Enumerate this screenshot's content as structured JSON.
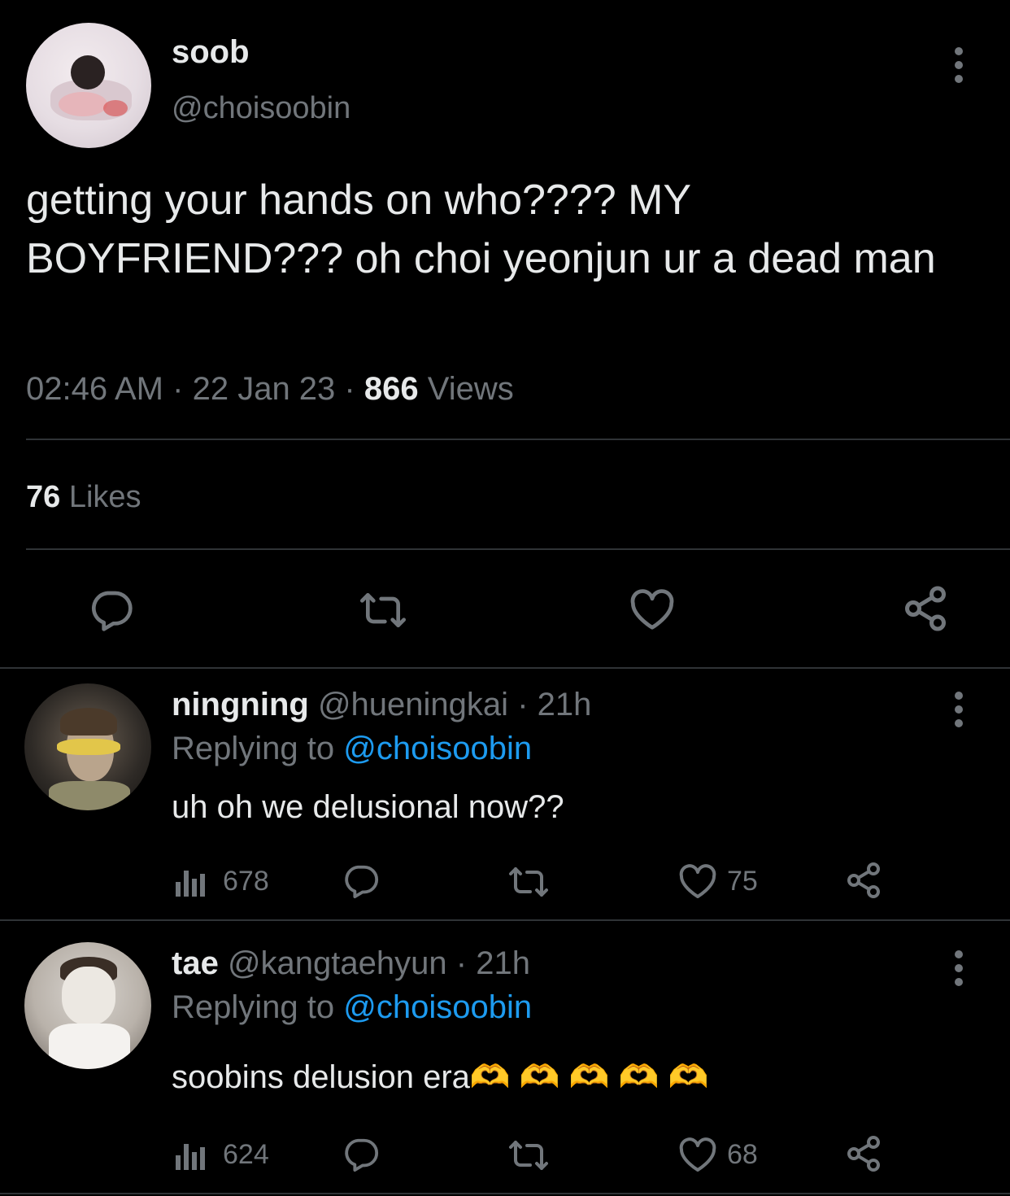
{
  "tweet": {
    "display_name": "soob",
    "handle": "@choisoobin",
    "text": "getting your hands on who???? MY BOYFRIEND??? oh choi yeonjun ur a dead man",
    "time": "02:46 AM",
    "date": "22 Jan 23",
    "separator": "·",
    "views_count": "866",
    "views_label": "Views",
    "likes_count": "76",
    "likes_label": "Likes"
  },
  "replies": [
    {
      "display_name": "ningning",
      "handle": "@hueningkai",
      "age": "21h",
      "replying_label": "Replying to",
      "replying_handle": "@choisoobin",
      "text": "uh oh we delusional now??",
      "views": "678",
      "likes": "75"
    },
    {
      "display_name": "tae",
      "handle": "@kangtaehyun",
      "age": "21h",
      "replying_label": "Replying to",
      "replying_handle": "@choisoobin",
      "text": "soobins delusion era",
      "emoji": "🫶 🫶 🫶 🫶 🫶",
      "views": "624",
      "likes": "68"
    }
  ],
  "colors": {
    "background": "#000000",
    "text": "#e7e9ea",
    "muted": "#71767b",
    "link": "#1d9bf0",
    "divider": "#2f3336"
  },
  "icons": [
    "more-icon",
    "reply-icon",
    "retweet-icon",
    "like-icon",
    "share-icon",
    "views-icon"
  ]
}
